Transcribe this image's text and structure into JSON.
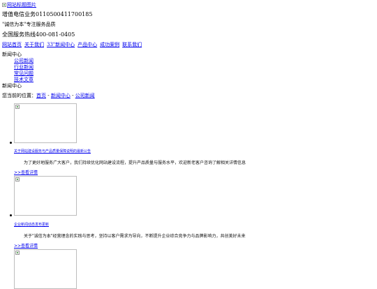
{
  "header": {
    "logo_alt": "网站标题图片",
    "registration": "增值电信业务0110500411700185",
    "slogan": "\"诚信为本\"专注服务品质",
    "phone": "全国服务热线400-081-0405"
  },
  "nav": {
    "items": [
      "网站首页",
      "关于我们",
      "33\"新闻中心",
      "产品中心",
      "成功案例",
      "联系我们"
    ]
  },
  "sidebar": {
    "title": "新闻中心",
    "items": [
      "公司新闻",
      "行业新闻",
      "常见问题",
      "技术文章"
    ]
  },
  "content": {
    "title": "新闻中心",
    "breadcrumb": {
      "prefix": "您当前的位置：",
      "home": "首页",
      "sep": "-",
      "section": "新闻中心",
      "current": "公司新闻"
    },
    "news": [
      {
        "title": "关于网站建设服务与产品质量保障说明的最新公告",
        "desc": "为了更好地服务广大客户，我们持续优化网站建设流程，提升产品质量与服务水平，欢迎新老客户咨询了解相关详情信息",
        "more": ">>查看详情"
      },
      {
        "title": "企业新闻动态发布更新",
        "desc": "关于\"诚信为本\"经营理念的实践与思考，坚持以客户需求为导向，不断提升企业综合竞争力与品牌影响力，共创美好未来",
        "more": ">>查看详情"
      },
      {
        "title": "",
        "desc": "",
        "more": ""
      }
    ]
  }
}
